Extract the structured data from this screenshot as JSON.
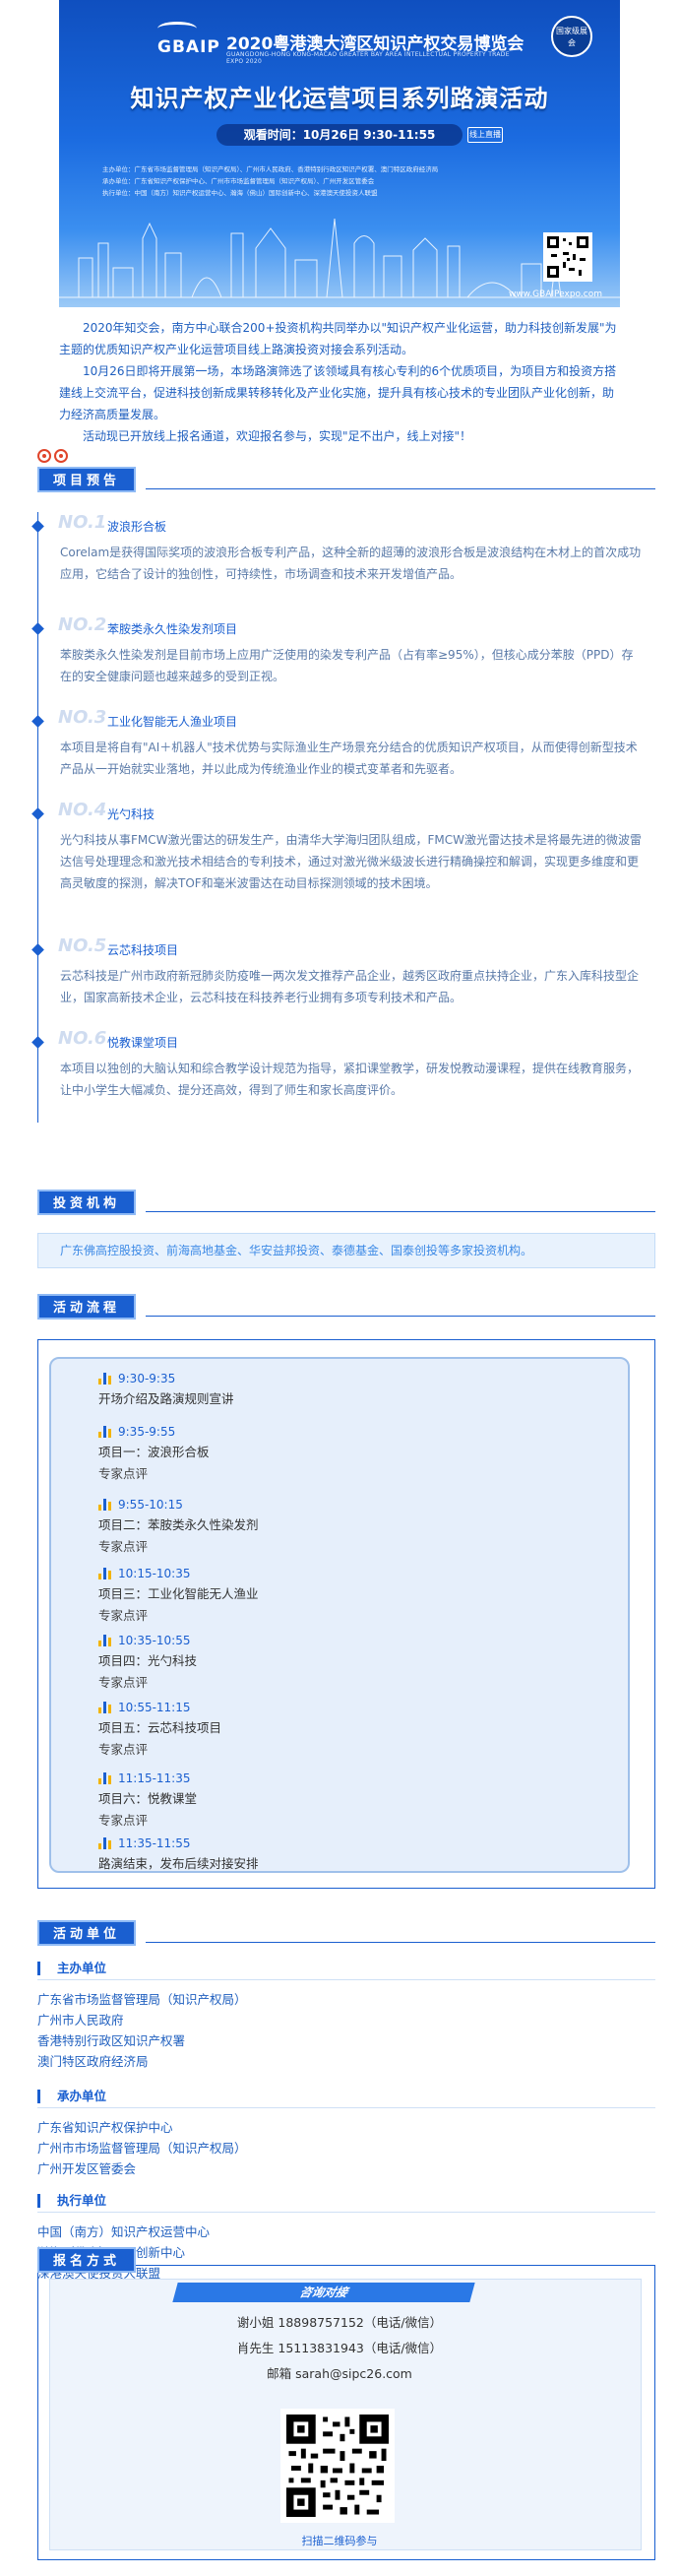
{
  "banner": {
    "logo": "GBAIP",
    "expo_title": "2020粤港澳大湾区知识产权交易博览会",
    "expo_en": "GUANGDONG-HONG KONG-MACAO GREATER BAY AREA INTELLECTUAL PROPERTY TRADE EXPO 2020",
    "badge": "国家级展会",
    "main_title": "知识产权产业化运营项目系列路演活动",
    "time": "观看时间：10月26日 9:30-11:55",
    "online_tag": "线上直播",
    "org_host": "主办单位：广东省市场监督管理局（知识产权局）、广州市人民政府、香港特别行政区知识产权署、澳门特区政府经济局",
    "org_undertake": "承办单位：广东省知识产权保护中心、广州市市场监督管理局（知识产权局）、广州开发区管委会",
    "org_execute": "执行单位：中国（南方）知识产权运营中心、瀚海（佛山）国际创新中心、深港澳天使投资人联盟",
    "website": "www.GBAIPexpo.com",
    "qr_icon": "qr-code-icon"
  },
  "intro": {
    "p1": "2020年知交会，南方中心联合200+投资机构共同举办以\"知识产权产业化运营，助力科技创新发展\"为主题的优质知识产权产业化运营项目线上路演投资对接会系列活动。",
    "p2": "10月26日即将开展第一场，本场路演筛选了该领域具有核心专利的6个优质项目，为项目方和投资方搭建线上交流平台，促进科技创新成果转移转化及产业化实施，提升具有核心技术的专业团队产业化创新，助力经济高质量发展。",
    "p3": "活动现已开放线上报名通道，欢迎报名参与，实现\"足不出户，线上对接\"！"
  },
  "sections": {
    "preview": "项目预告",
    "investors": "投资机构",
    "schedule": "活动流程",
    "units": "活动单位",
    "signup": "报名方式"
  },
  "preview_items": [
    {
      "num": "NO.1",
      "name": "波浪形合板",
      "desc": "Corelam是获得国际奖项的波浪形合板专利产品，这种全新的超薄的波浪形合板是波浪结构在木材上的首次成功应用，它结合了设计的独创性，可持续性，市场调查和技术来开发增值产品。"
    },
    {
      "num": "NO.2",
      "name": "苯胺类永久性染发剂项目",
      "desc": "苯胺类永久性染发剂是目前市场上应用广泛使用的染发专利产品（占有率≥95%），但核心成分苯胺（PPD）存在的安全健康问题也越来越多的受到正视。"
    },
    {
      "num": "NO.3",
      "name": "工业化智能无人渔业项目",
      "desc": "本项目是将自有\"AI＋机器人\"技术优势与实际渔业生产场景充分结合的优质知识产权项目，从而使得创新型技术产品从一开始就实业落地，并以此成为传统渔业作业的模式变革者和先驱者。"
    },
    {
      "num": "NO.4",
      "name": "光勺科技",
      "desc": "光勺科技从事FMCW激光雷达的研发生产，由清华大学海归团队组成，FMCW激光雷达技术是将最先进的微波雷达信号处理理念和激光技术相结合的专利技术，通过对激光微米级波长进行精确操控和解调，实现更多维度和更高灵敏度的探测，解决TOF和毫米波雷达在动目标探测领域的技术困境。"
    },
    {
      "num": "NO.5",
      "name": "云芯科技项目",
      "desc": "云芯科技是广州市政府新冠肺炎防疫唯一两次发文推荐产品企业，越秀区政府重点扶持企业，广东入库科技型企业，国家高新技术企业，云芯科技在科技养老行业拥有多项专利技术和产品。"
    },
    {
      "num": "NO.6",
      "name": "悦教课堂项目",
      "desc": "本项目以独创的大脑认知和综合教学设计规范为指导，紧扣课堂教学，研发悦教动漫课程，提供在线教育服务，让中小学生大幅减负、提分还高效，得到了师生和家长高度评价。"
    }
  ],
  "investors_text": "广东佛高控股投资、前海高地基金、华安益邦投资、泰德基金、国泰创投等多家投资机构。",
  "schedule": [
    {
      "time": "9:30-9:35",
      "line1": "开场介绍及路演规则宣讲",
      "line2": ""
    },
    {
      "time": "9:35-9:55",
      "line1": "项目一：波浪形合板",
      "line2": "专家点评"
    },
    {
      "time": "9:55-10:15",
      "line1": "项目二：苯胺类永久性染发剂",
      "line2": "专家点评"
    },
    {
      "time": "10:15-10:35",
      "line1": "项目三：工业化智能无人渔业",
      "line2": "专家点评"
    },
    {
      "time": "10:35-10:55",
      "line1": "项目四：光勺科技",
      "line2": "专家点评"
    },
    {
      "time": "10:55-11:15",
      "line1": "项目五：云芯科技项目",
      "line2": "专家点评"
    },
    {
      "time": "11:15-11:35",
      "line1": "项目六：悦教课堂",
      "line2": "专家点评"
    },
    {
      "time": "11:35-11:55",
      "line1": "路演结束，发布后续对接安排",
      "line2": ""
    }
  ],
  "units": {
    "host_title": "主办单位",
    "host": [
      "广东省市场监督管理局（知识产权局）",
      "广州市人民政府",
      "香港特别行政区知识产权署",
      "澳门特区政府经济局"
    ],
    "undertake_title": "承办单位",
    "undertake": [
      "广东省知识产权保护中心",
      "广州市市场监督管理局（知识产权局）",
      "广州开发区管委会"
    ],
    "execute_title": "执行单位",
    "execute": [
      "中国（南方）知识产权运营中心",
      "瀚海（佛山）国际创新中心",
      "深港澳天使投资人联盟"
    ]
  },
  "contact": {
    "head": "咨询对接",
    "line1": "谢小姐 18898757152（电话/微信）",
    "line2": "肖先生 15113831943（电话/微信）",
    "line3": "邮箱  sarah@sipc26.com",
    "scan": "扫描二维码参与",
    "qr_icon": "qr-code-icon"
  },
  "colors": {
    "primary": "#1a5fd0",
    "text_blue": "#1f5fbf",
    "accent_red": "#e0452b"
  }
}
